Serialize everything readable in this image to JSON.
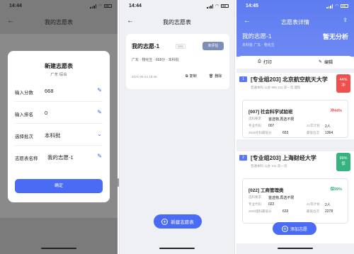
{
  "panel1": {
    "status_time": "14:44",
    "title": "我的志愿表",
    "modal": {
      "title": "新建志愿表",
      "subtitle": "广东 综合",
      "rows": [
        {
          "label": "输入分数",
          "value": "668"
        },
        {
          "label": "输入排名",
          "value": "0"
        },
        {
          "label": "选择批次",
          "value": "本科批"
        },
        {
          "label": "志愿表名称",
          "value": "我的志愿-1"
        }
      ],
      "confirm_label": "确定"
    }
  },
  "panel2": {
    "status_time": "14:44",
    "title": "我的志愿表",
    "card": {
      "name": "我的志愿-1",
      "code": "(69)",
      "tag": "未评估",
      "info": "广东 · 物化生 · 668分 · 本科批",
      "date": "2021-06-24 18:46",
      "copy_label": "复制",
      "delete_label": "删除"
    },
    "new_button": "新建志愿表"
  },
  "panel3": {
    "status_time": "14:45",
    "title": "志愿表详情",
    "sheet_name": "我的志愿-1",
    "sheet_sub": "本科批  广东 · 物化生",
    "analysis": "暂无分析",
    "analysis_sub": "",
    "print_label": "打印",
    "edit_label": "编辑",
    "universities": [
      {
        "num": "1",
        "name": "[专业组203] 北京航空航天大学",
        "sub": "普通本科  公办  985 211 双一流  理科",
        "pct": "44%",
        "risk": "冲",
        "color": "#f0504b",
        "major": "[007] 社会科学试验班",
        "major_pct": "冲44%",
        "major_color": "#f0504b",
        "subject_label": "选科要求",
        "subject": "首选物,再选不限",
        "code_label": "专业代码",
        "code": "007",
        "plan_label": "21年计划",
        "plan": "2人",
        "score_label": "2019文科最低分",
        "score": "653",
        "rank_label": "最低位次",
        "rank": "1364"
      },
      {
        "num": "2",
        "name": "[专业组203] 上海财经大学",
        "sub": "普通本科  公办  211 双一流",
        "pct": "99%",
        "risk": "保",
        "color": "#36b37e",
        "major": "[022] 工商管理类",
        "major_pct": "保99%",
        "major_color": "#36b37e",
        "subject_label": "选科要求",
        "subject": "首选物,再选不限",
        "code_label": "专业代码",
        "code": "022",
        "plan_label": "21年计划",
        "plan": "2人",
        "score_label": "2020理科最低分",
        "score": "633",
        "rank_label": "最低位次",
        "rank": "2278"
      }
    ],
    "add_button": "添加志愿"
  }
}
